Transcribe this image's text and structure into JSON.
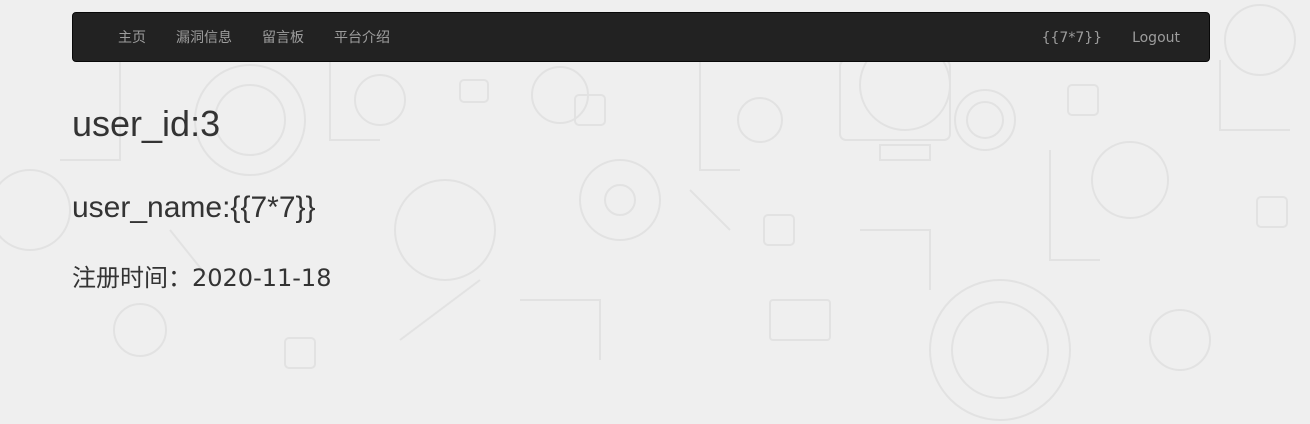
{
  "navbar": {
    "left_items": [
      {
        "label": "主页"
      },
      {
        "label": "漏洞信息"
      },
      {
        "label": "留言板"
      },
      {
        "label": "平台介绍"
      }
    ],
    "username_link": "{{7*7}}",
    "logout_label": "Logout"
  },
  "profile": {
    "user_id_text": "user_id:3",
    "user_name_text": "user_name:{{7*7}}",
    "register_time_text": "注册时间：2020-11-18"
  },
  "colors": {
    "background": "#efefef",
    "navbar_bg": "#222222",
    "nav_link": "#9d9d9d",
    "text": "#333333"
  }
}
